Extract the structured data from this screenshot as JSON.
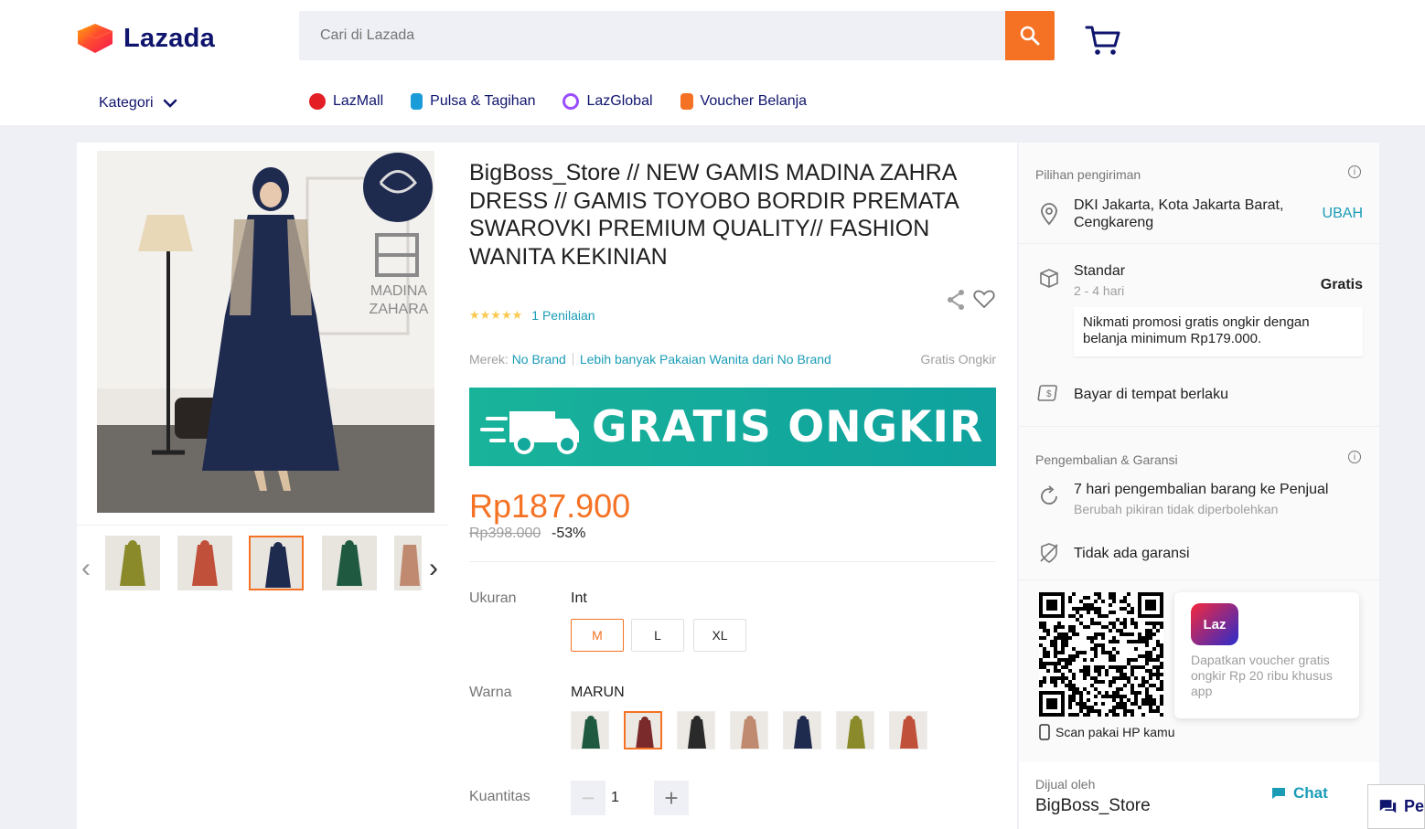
{
  "header": {
    "logo_text": "Lazada",
    "search_placeholder": "Cari di Lazada",
    "kategori_label": "Kategori",
    "nav": [
      {
        "label": "LazMall",
        "icon": "lazmall-icon",
        "color": "#e31e24"
      },
      {
        "label": "Pulsa & Tagihan",
        "icon": "phone-bill-icon",
        "color": "#1a9cd8"
      },
      {
        "label": "LazGlobal",
        "icon": "lazglobal-icon",
        "color": "#9b4dff"
      },
      {
        "label": "Voucher Belanja",
        "icon": "voucher-icon",
        "color": "#f57224"
      }
    ]
  },
  "product": {
    "title": "BigBoss_Store // NEW GAMIS MADINA ZAHRA DRESS // GAMIS TOYOBO BORDIR PREMATA SWAROVKI PREMIUM QUALITY// FASHION WANITA KEKINIAN",
    "image_brand": "MADINA ZAHARA",
    "rating_stars": 5,
    "rating_link": "1 Penilaian",
    "brand_label": "Merek:",
    "brand_name": "No Brand",
    "more_link": "Lebih banyak Pakaian Wanita dari No Brand",
    "free_shipping_tag": "Gratis Ongkir",
    "banner_text": "GRATIS ONGKIR",
    "price": "Rp187.900",
    "price_old": "Rp398.000",
    "discount": "-53%",
    "size_label": "Ukuran",
    "size_value": "Int",
    "sizes": [
      "M",
      "L",
      "XL"
    ],
    "selected_size": "M",
    "color_label": "Warna",
    "color_value": "MARUN",
    "quantity_label": "Kuantitas",
    "quantity": "1",
    "thumb_colors": [
      "#8a8a2a",
      "#c0503a",
      "#1f2a4f",
      "#1f5a40",
      "#c08a70"
    ],
    "swatch_colors": [
      "#1f5a40",
      "#7a2a2a",
      "#2a2a2a",
      "#c08a70",
      "#1f2a4f",
      "#8a8a2a",
      "#c0503a"
    ]
  },
  "sidebar": {
    "delivery_head": "Pilihan pengiriman",
    "location": "DKI Jakarta, Kota Jakarta Barat, Cengkareng",
    "change_link": "UBAH",
    "standard_label": "Standar",
    "standard_days": "2 - 4 hari",
    "standard_price": "Gratis",
    "promo_text": "Nikmati promosi gratis ongkir dengan belanja minimum Rp179.000.",
    "cod_text": "Bayar di tempat berlaku",
    "return_head": "Pengembalian & Garansi",
    "return_text": "7 hari pengembalian barang ke Penjual",
    "return_sub": "Berubah pikiran tidak diperbolehkan",
    "warranty_text": "Tidak ada garansi",
    "app_icon_text": "Laz",
    "app_text": "Dapatkan voucher gratis ongkir Rp 20 ribu khusus app",
    "scan_text": "Scan pakai HP kamu",
    "sold_by_label": "Dijual oleh",
    "seller_name": "BigBoss_Store",
    "chat_label": "Chat"
  },
  "floating": {
    "label": "Pe"
  }
}
